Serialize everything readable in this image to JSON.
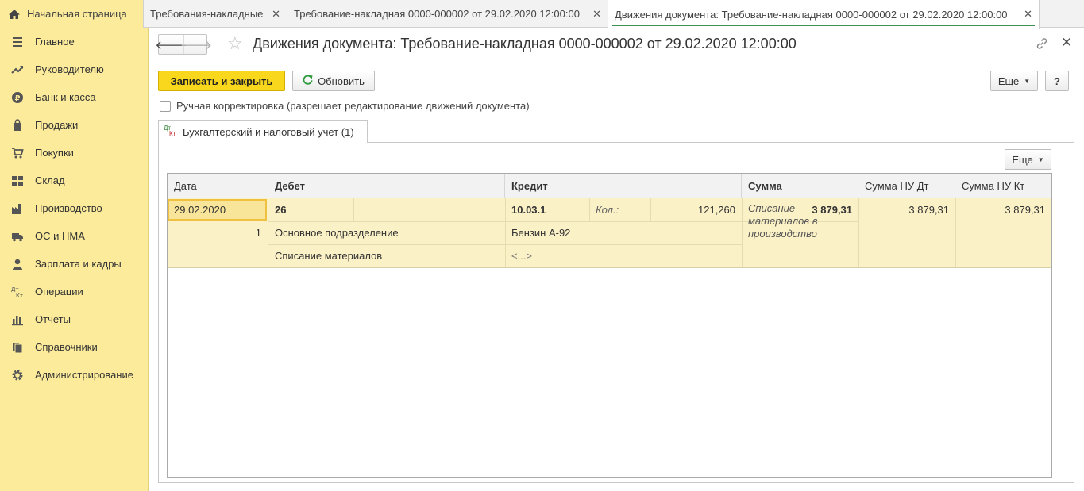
{
  "tabs": {
    "home": "Начальная страница",
    "tab1": "Требования-накладные",
    "tab2": "Требование-накладная 0000-000002 от 29.02.2020 12:00:00",
    "tab3": "Движения документа: Требование-накладная 0000-000002 от 29.02.2020 12:00:00",
    "close_glyph": "✕"
  },
  "sidebar": {
    "items": [
      {
        "label": "Главное",
        "icon": "menu-icon"
      },
      {
        "label": "Руководителю",
        "icon": "trend-icon"
      },
      {
        "label": "Банк и касса",
        "icon": "ruble-icon"
      },
      {
        "label": "Продажи",
        "icon": "bag-icon"
      },
      {
        "label": "Покупки",
        "icon": "cart-icon"
      },
      {
        "label": "Склад",
        "icon": "warehouse-icon"
      },
      {
        "label": "Производство",
        "icon": "factory-icon"
      },
      {
        "label": "ОС и НМА",
        "icon": "truck-icon"
      },
      {
        "label": "Зарплата и кадры",
        "icon": "person-icon"
      },
      {
        "label": "Операции",
        "icon": "dt-kt-icon"
      },
      {
        "label": "Отчеты",
        "icon": "bar-chart-icon"
      },
      {
        "label": "Справочники",
        "icon": "books-icon"
      },
      {
        "label": "Администрирование",
        "icon": "gear-icon"
      }
    ]
  },
  "form": {
    "title": "Движения документа: Требование-накладная 0000-000002 от 29.02.2020 12:00:00",
    "back_glyph": "🡐",
    "forward_glyph": "🡒",
    "star_glyph": "☆",
    "close_glyph": "✕"
  },
  "toolbar": {
    "save_close": "Записать и закрыть",
    "refresh": "Обновить",
    "more": "Еще",
    "help": "?"
  },
  "manual_edit": {
    "label": "Ручная корректировка (разрешает редактирование движений документа)",
    "checked": false
  },
  "doc_tab": {
    "label": "Бухгалтерский и налоговый учет (1)",
    "icon_dt": "Дт",
    "icon_kt": "Кт"
  },
  "grid": {
    "more": "Еще",
    "columns": [
      "Дата",
      "Дебет",
      "Кредит",
      "Сумма",
      "Сумма НУ Дт",
      "Сумма НУ Кт"
    ],
    "row": {
      "date": "29.02.2020",
      "line_no": "1",
      "debit_account": "26",
      "debit_subconto1": "Основное подразделение",
      "debit_subconto2": "Списание материалов",
      "credit_account": "10.03.1",
      "qty_label": "Кол.:",
      "qty_value": "121,260",
      "credit_subconto1": "Бензин А-92",
      "credit_subconto2": "<...>",
      "sum": "3 879,31",
      "description": "Списание материалов в производство",
      "sum_nu_dt": "3 879,31",
      "sum_nu_kt": "3 879,31"
    }
  }
}
